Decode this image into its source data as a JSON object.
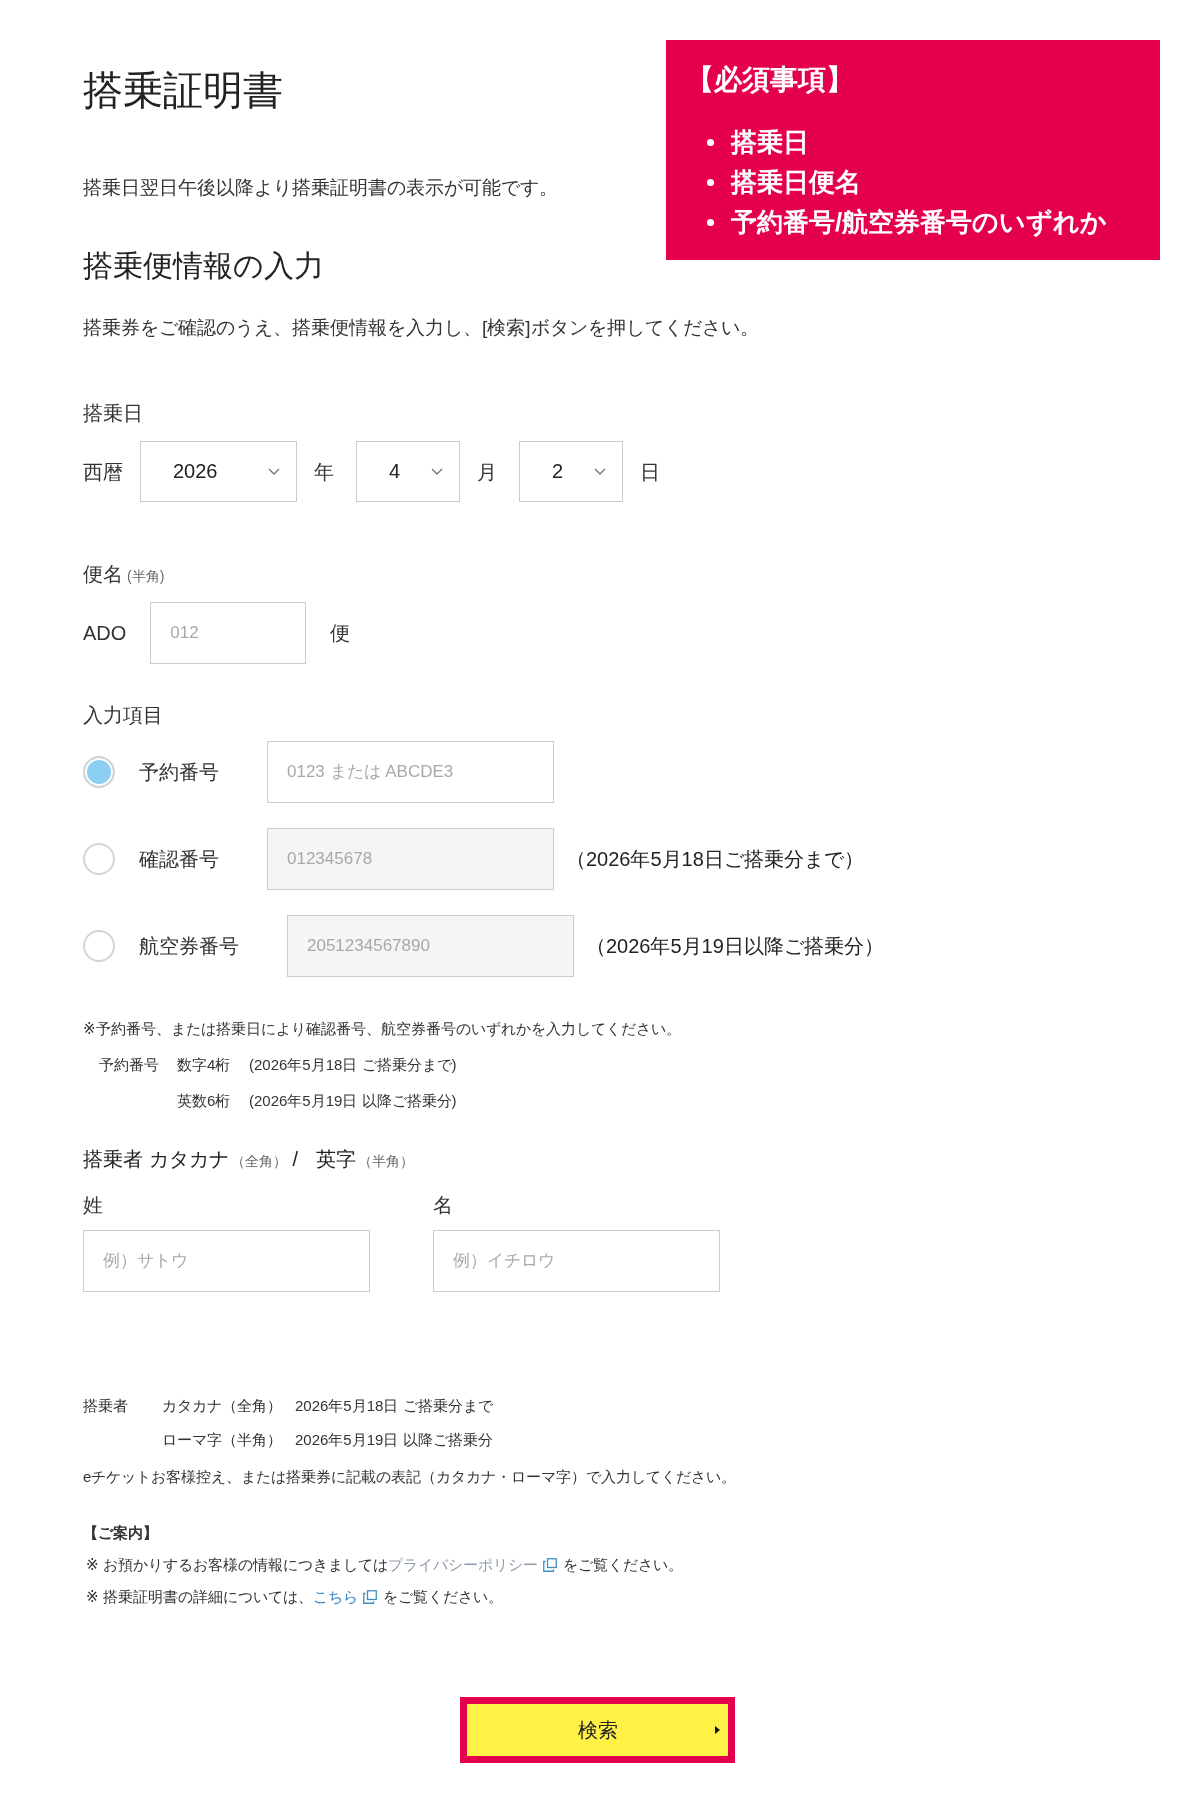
{
  "page": {
    "title": "搭乗証明書",
    "availability_note": "搭乗日翌日午後以降より搭乗証明書の表示が可能です。",
    "section_title": "搭乗便情報の入力",
    "instruction": "搭乗券をご確認のうえ、搭乗便情報を入力し、[検索]ボタンを押してください。"
  },
  "required_box": {
    "heading": "【必須事項】",
    "items": [
      "搭乗日",
      "搭乗日便名",
      "予約番号/航空券番号のいずれか"
    ]
  },
  "boarding_date": {
    "label": "搭乗日",
    "era_label": "西暦",
    "fields": [
      {
        "value": "2026",
        "unit": "年"
      },
      {
        "value": "4",
        "unit": "月"
      },
      {
        "value": "2",
        "unit": "日"
      }
    ]
  },
  "flight": {
    "label": "便名",
    "label_note": "(半角)",
    "prefix": "ADO",
    "placeholder": "012",
    "suffix": "便"
  },
  "input_type": {
    "label": "入力項目",
    "options": [
      {
        "label": "予約番号",
        "selected": true,
        "placeholder": "0123 または ABCDE3"
      },
      {
        "label": "確認番号",
        "selected": false,
        "placeholder": "012345678",
        "note": "（2026年5月18日ご搭乗分まで）"
      },
      {
        "label": "航空券番号",
        "selected": false,
        "placeholder": "2051234567890",
        "note": "（2026年5月19日以降ご搭乗分）"
      }
    ]
  },
  "input_notes": {
    "text": "※予約番号、または搭乗日により確認番号、航空券番号のいずれかを入力してください。",
    "rows": [
      {
        "label": "予約番号",
        "format": "数字4桁",
        "period": "(2026年5月18日 ご搭乗分まで)"
      },
      {
        "format": "英数6桁",
        "period": "(2026年5月19日 以降ご搭乗分)"
      }
    ]
  },
  "passenger": {
    "heading": "搭乗者 カタカナ",
    "heading_note": "（全角）",
    "separator": "/",
    "heading_alt": "英字",
    "heading_alt_note": "（半角）",
    "fields": [
      {
        "label": "姓",
        "placeholder": "例）サトウ"
      },
      {
        "label": "名",
        "placeholder": "例）イチロウ"
      }
    ]
  },
  "passenger_notes": {
    "rows": [
      {
        "label": "搭乗者",
        "script": "カタカナ（全角）",
        "period": "2026年5月18日 ご搭乗分まで"
      },
      {
        "script": "ローマ字（半角）",
        "period": "2026年5月19日 以降ご搭乗分"
      }
    ],
    "text": "eチケットお客様控え、または搭乗券に記載の表記（カタカナ・ローマ字）で入力してください。"
  },
  "guidance": {
    "heading": "【ご案内】",
    "items": [
      {
        "before": "※ お預かりするお客様の情報につきましては",
        "link": "プライバシーポリシー",
        "visited": true,
        "after": "をご覧ください。"
      },
      {
        "before": "※ 搭乗証明書の詳細については、",
        "link": "こちら",
        "visited": false,
        "after": "をご覧ください。"
      }
    ]
  },
  "search_button": {
    "label": "検索"
  }
}
